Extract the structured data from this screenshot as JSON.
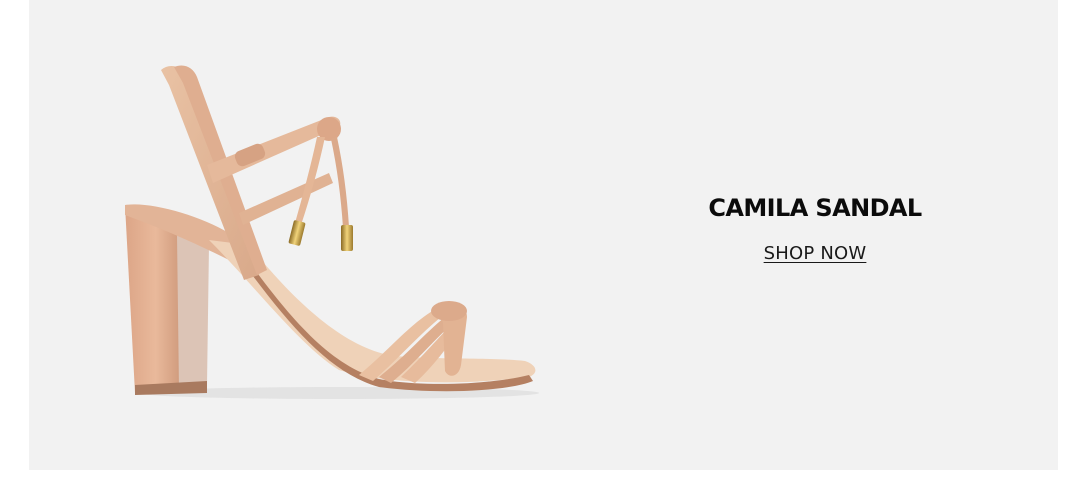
{
  "banner": {
    "background_color": "#f2f2f2",
    "product_title": "CAMILA SANDAL",
    "cta_label": "SHOP NOW",
    "product_image_icon": "nude-strappy-block-heel-sandal-illustration",
    "colors": {
      "leather": "#e7bd9e",
      "leather_shadow": "#cf9f80",
      "heel": "#e3b092",
      "hardware": "#c9a24a"
    }
  }
}
